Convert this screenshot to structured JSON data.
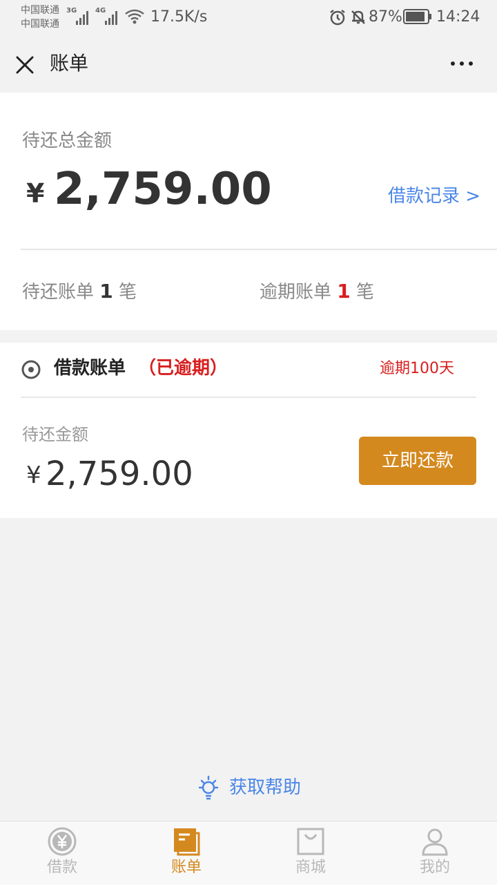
{
  "status_bar": {
    "carrier_1": "中国联通",
    "carrier_2": "中国联通",
    "network_1": "3G",
    "network_2": "4G",
    "speed": "17.5K/s",
    "battery": "87%",
    "time": "14:24"
  },
  "header": {
    "title": "账单"
  },
  "summary": {
    "total_label": "待还总金额",
    "currency": "¥",
    "total_amount": "2,759.00",
    "loan_record_link": "借款记录 >",
    "pending_prefix": "待还账单",
    "pending_count": "1",
    "pending_suffix": "笔",
    "overdue_prefix": "逾期账单",
    "overdue_count": "1",
    "overdue_suffix": "笔"
  },
  "bill": {
    "title": "借款账单",
    "status": "（已逾期）",
    "overdue_days": "逾期100天",
    "due_label": "待还金额",
    "currency": "¥",
    "amount": "2,759.00",
    "pay_button": "立即还款"
  },
  "help": {
    "label": "获取帮助"
  },
  "bottom_nav": {
    "items": [
      {
        "label": "借款",
        "active": false
      },
      {
        "label": "账单",
        "active": true
      },
      {
        "label": "商城",
        "active": false
      },
      {
        "label": "我的",
        "active": false
      }
    ]
  },
  "colors": {
    "accent": "#d4891f",
    "link": "#4a86e8",
    "alert": "#d81e1e"
  }
}
